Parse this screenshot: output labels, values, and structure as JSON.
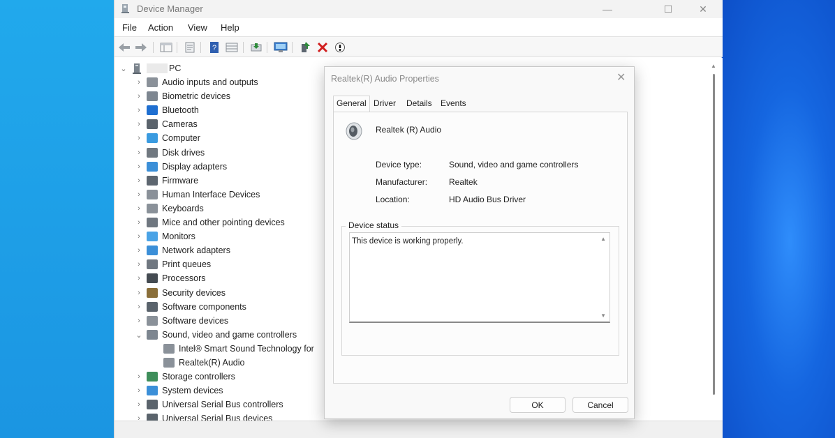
{
  "window": {
    "title": "Device Manager",
    "controls": {
      "minimize": "—",
      "maximize": "☐",
      "close": "✕"
    }
  },
  "menu": [
    "File",
    "Action",
    "View",
    "Help"
  ],
  "toolbar": {
    "icons": [
      "back-arrow-icon",
      "forward-arrow-icon",
      "show-hide-console-tree-icon",
      "properties-icon",
      "help-icon",
      "view-icon",
      "update-driver-icon",
      "scan-hardware-icon",
      "add-driver-icon",
      "uninstall-icon",
      "disable-device-icon"
    ]
  },
  "tree": {
    "root": "PC",
    "categories": [
      "Audio inputs and outputs",
      "Biometric devices",
      "Bluetooth",
      "Cameras",
      "Computer",
      "Disk drives",
      "Display adapters",
      "Firmware",
      "Human Interface Devices",
      "Keyboards",
      "Mice and other pointing devices",
      "Monitors",
      "Network adapters",
      "Print queues",
      "Processors",
      "Security devices",
      "Software components",
      "Software devices",
      "Sound, video and game controllers"
    ],
    "expanded_children": [
      "Intel® Smart Sound Technology for",
      "Realtek(R) Audio"
    ],
    "categories_after": [
      "Storage controllers",
      "System devices",
      "Universal Serial Bus controllers",
      "Universal Serial Bus devices"
    ]
  },
  "dialog": {
    "title": "Realtek(R) Audio Properties",
    "close": "✕",
    "tabs": [
      "General",
      "Driver",
      "Details",
      "Events"
    ],
    "device_name": "Realtek (R) Audio",
    "fields": [
      {
        "label": "Device type:",
        "value": "Sound, video and game controllers"
      },
      {
        "label": "Manufacturer:",
        "value": "Realtek"
      },
      {
        "label": "Location:",
        "value": "HD Audio Bus Driver"
      }
    ],
    "status_group": "Device status",
    "status_text": "This device is working properly.",
    "ok": "OK",
    "cancel": "Cancel"
  },
  "colors": {
    "accent_blue": "#0078d4",
    "uninstall_red": "#d11f1f",
    "add_green": "#2e8b3a"
  }
}
